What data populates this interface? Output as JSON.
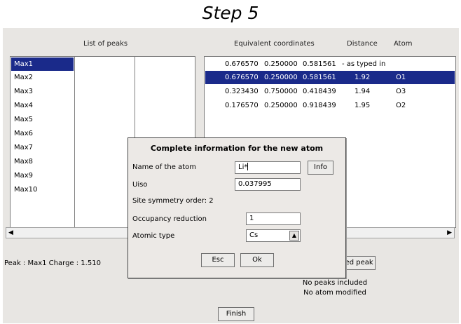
{
  "step_title": "Step 5",
  "headers": {
    "list_of_peaks": "List of peaks",
    "equivalent_coordinates": "Equivalent coordinates",
    "distance": "Distance",
    "atom": "Atom"
  },
  "peaks": [
    "Max1",
    "Max2",
    "Max3",
    "Max4",
    "Max5",
    "Max6",
    "Max7",
    "Max8",
    "Max9",
    "Max10"
  ],
  "coordinates": [
    {
      "x": "0.676570",
      "y": "0.250000",
      "z": "0.581561",
      "distance": "- as typed in",
      "atom": ""
    },
    {
      "x": "0.676570",
      "y": "0.250000",
      "z": "0.581561",
      "distance": "1.92",
      "atom": "O1"
    },
    {
      "x": "0.323430",
      "y": "0.750000",
      "z": "0.418439",
      "distance": "1.94",
      "atom": "O3"
    },
    {
      "x": "0.176570",
      "y": "0.250000",
      "z": "0.918439",
      "distance": "1.95",
      "atom": "O2"
    }
  ],
  "dialog": {
    "title": "Complete information for the new atom",
    "name_label": "Name of the atom",
    "name_value": "Li*",
    "info_button": "Info",
    "uiso_label": "Uiso",
    "uiso_value": "0.037995",
    "site_symmetry": "Site symmetry order:  2",
    "occupancy_label": "Occupancy reduction",
    "occupancy_value": "1",
    "atomic_type_label": "Atomic type",
    "atomic_type_value": "Cs",
    "esc_button": "Esc",
    "ok_button": "Ok"
  },
  "status": {
    "peak_info": "Peak : Max1   Charge : 1.510",
    "include_button": "Include selected peak",
    "no_peaks": "No peaks included",
    "no_atom": "No atom modified",
    "finish_button": "Finish"
  }
}
